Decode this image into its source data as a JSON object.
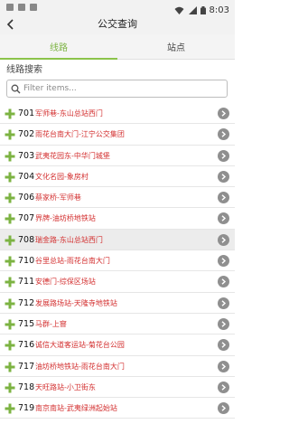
{
  "status_bar": {
    "time": "8:03"
  },
  "app_bar": {
    "title": "公交查询"
  },
  "tabs": [
    {
      "label": "线路",
      "active": true
    },
    {
      "label": "站点",
      "active": false
    }
  ],
  "search": {
    "section_label": "线路搜索",
    "placeholder": "Filter items..."
  },
  "colors": {
    "accent": "#8bc34a",
    "route_text": "#d32f2f",
    "plus_icon": "#7cb342",
    "chevron_bg": "#8f8f8f"
  },
  "routes": [
    {
      "number": "701",
      "name": "军师巷-东山总站西门"
    },
    {
      "number": "702",
      "name": "雨花台南大门-江宁公交集团"
    },
    {
      "number": "703",
      "name": "武夷花园东-中华门城堡"
    },
    {
      "number": "704",
      "name": "文化名园-象房村"
    },
    {
      "number": "706",
      "name": "蔡家桥-军师巷"
    },
    {
      "number": "707",
      "name": "界牌-油坊桥地铁站"
    },
    {
      "number": "708",
      "name": "瑞金路-东山总站西门",
      "highlight": true
    },
    {
      "number": "710",
      "name": "谷里总站-雨花台南大门"
    },
    {
      "number": "711",
      "name": "安德门-综保区场站"
    },
    {
      "number": "712",
      "name": "发展路场站-天隆寺地铁站"
    },
    {
      "number": "715",
      "name": "马群-上窨"
    },
    {
      "number": "716",
      "name": "诚信大道客运站-菊花台公园"
    },
    {
      "number": "717",
      "name": "油坊桥地铁站-雨花台南大门"
    },
    {
      "number": "718",
      "name": "天旺路站-小卫街东"
    },
    {
      "number": "719",
      "name": "南京南站-武夷绿洲起始站"
    }
  ]
}
